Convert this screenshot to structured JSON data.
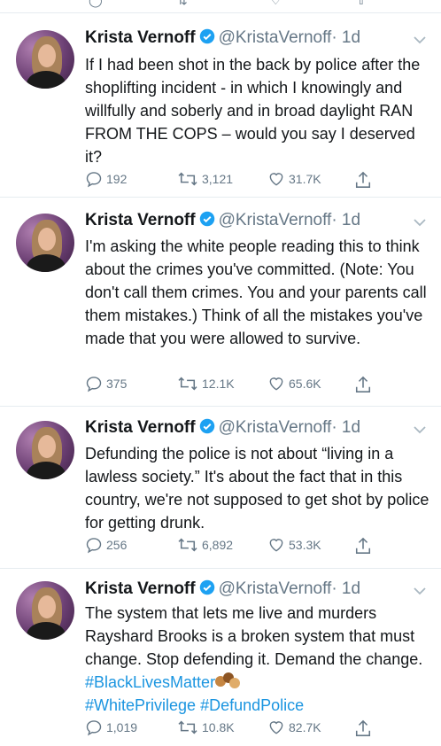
{
  "app": "Twitter",
  "colors": {
    "text": "#14171a",
    "secondary": "#657786",
    "link": "#1b95e0",
    "verified": "#1da1f2"
  },
  "tweets": [
    {
      "name": "Krista Vernoff",
      "handle": "@KristaVernoff",
      "time": "· 1d",
      "text": "If I had been shot in the back by police after the shoplifting incident - in which I knowingly and willfully and soberly and in broad daylight RAN FROM THE COPS – would you say I deserved it?",
      "replies": "192",
      "retweets": "3,121",
      "likes": "31.7K"
    },
    {
      "name": "Krista Vernoff",
      "handle": "@KristaVernoff",
      "time": "· 1d",
      "text": "I'm asking the white people reading this to think about the crimes you've committed. (Note: You don't call them crimes. You and your parents call them mistakes.) Think of all the mistakes you've made that you were allowed to survive.",
      "replies": "375",
      "retweets": "12.1K",
      "likes": "65.6K"
    },
    {
      "name": "Krista Vernoff",
      "handle": "@KristaVernoff",
      "time": "· 1d",
      "text": "Defunding the police is not about “living in a lawless society.” It's about the fact that in this country, we're not supposed to get shot by police for getting drunk.",
      "replies": "256",
      "retweets": "6,892",
      "likes": "53.3K"
    },
    {
      "name": "Krista Vernoff",
      "handle": "@KristaVernoff",
      "time": "· 1d",
      "text": "The system that lets me live and murders Rayshard Brooks is a broken system that must change. Stop defending it. Demand the change. ",
      "hashtags": [
        "#BlackLivesMatter",
        "#WhitePrivilege",
        "#DefundPolice"
      ],
      "emoji": "raised-fists-emoji",
      "replies": "1,019",
      "retweets": "10.8K",
      "likes": "82.7K"
    }
  ]
}
